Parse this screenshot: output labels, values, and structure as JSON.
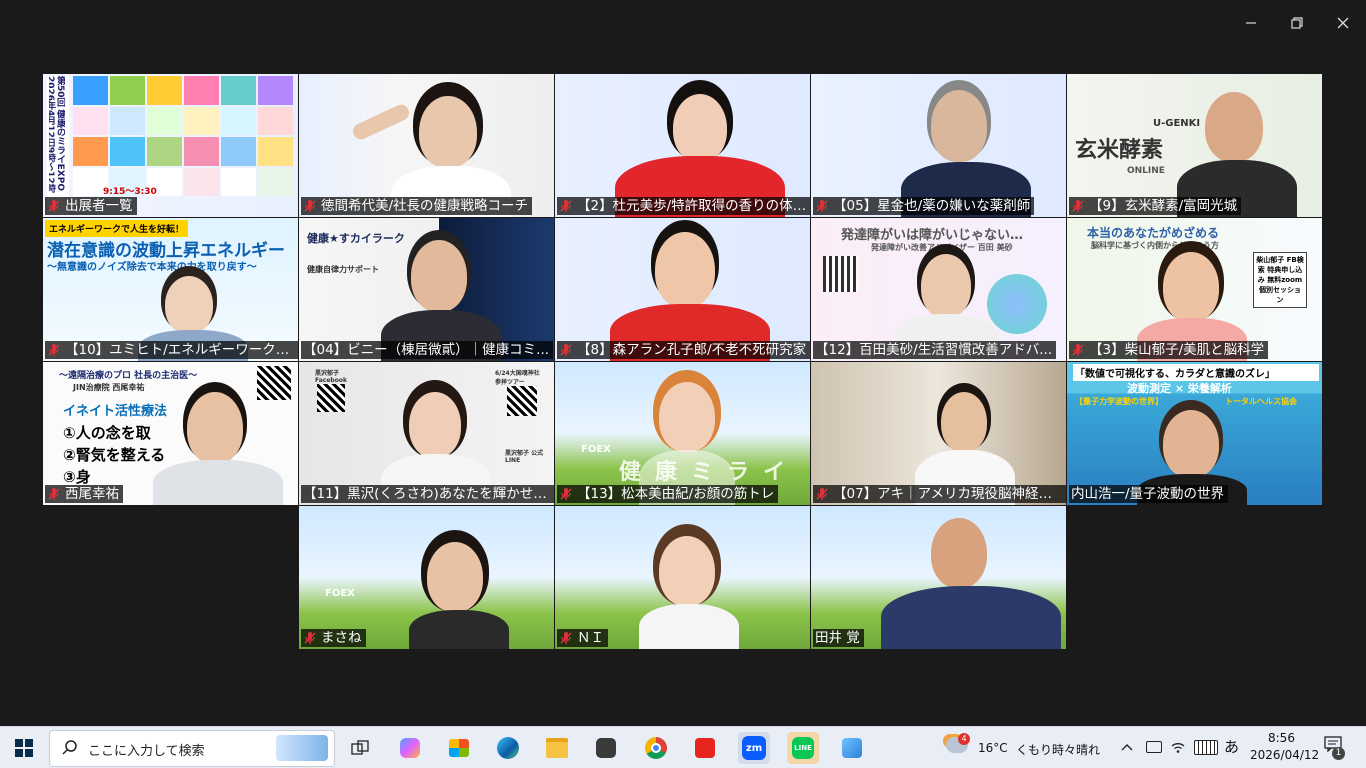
{
  "window": {
    "minimize_icon": "minimize-icon",
    "restore_icon": "restore-icon",
    "close_icon": "close-icon"
  },
  "participants": [
    {
      "name": "出展者一覧",
      "muted": true,
      "kind": "poster"
    },
    {
      "name": "徳間希代美/社長の健康戦略コーチ",
      "muted": true,
      "kind": "person"
    },
    {
      "name": "【2】杜元美歩/特許取得の香りの体質...",
      "muted": true,
      "kind": "person"
    },
    {
      "name": "【05】星金也/薬の嫌いな薬剤師",
      "muted": true,
      "kind": "person"
    },
    {
      "name": "【9】玄米酵素/富岡光城",
      "muted": true,
      "kind": "person"
    },
    {
      "name": "【10】ユミヒト/エネルギーワークで人...",
      "muted": true,
      "kind": "person"
    },
    {
      "name": "【04】ビニー（棟居微貳）｜健康コミ...",
      "muted": false,
      "kind": "person"
    },
    {
      "name": "【8】森アラン孔子郎/不老不死研究家",
      "muted": true,
      "kind": "person"
    },
    {
      "name": "【12】百田美砂/生活習慣改善アドバ...",
      "muted": false,
      "kind": "person"
    },
    {
      "name": "【3】柴山郁子/美肌と脳科学",
      "muted": true,
      "kind": "person"
    },
    {
      "name": "西尾幸祐",
      "muted": true,
      "kind": "person"
    },
    {
      "name": "【11】黒沢(くろさわ)あなたを輝かせるソ...",
      "muted": false,
      "kind": "person"
    },
    {
      "name": "【13】松本美由紀/お顔の筋トレ",
      "muted": true,
      "kind": "person"
    },
    {
      "name": "【07】アキ｜アメリカ現役脳神経科...",
      "muted": true,
      "kind": "person"
    },
    {
      "name": "内山浩一/量子波動の世界",
      "muted": false,
      "kind": "person"
    },
    {
      "name": "まさね",
      "muted": true,
      "kind": "person"
    },
    {
      "name": "ＮＩ",
      "muted": true,
      "kind": "person"
    },
    {
      "name": "田井 覚",
      "muted": false,
      "kind": "person",
      "speaking": true
    }
  ],
  "posters": {
    "expo_vertical": "第50回 健康のミライEXPO 2026年4月12日9時〜12時",
    "expo_times": "9:15〜3:30",
    "energy_banner": "エネルギーワークで人生を好転！",
    "energy_title": "潜在意識の波動上昇エネルギー",
    "energy_sub": "〜無意識のノイズ除去で本来の力を取り戻す〜",
    "kenko_star": "健康★すカイラーク",
    "kenko_jiritsu": "健康自律力サポート",
    "genmai": "玄米酵素",
    "genki": "U-GENKI",
    "online": "ONLINE",
    "hattatsu_title": "発達障がいは障がいじゃない…",
    "hattatsu_sub": "発達障がい改善アドバイザー 百田 美砂",
    "hontou_title": "本当のあなたがめざめる",
    "hontou_sub": "脳科学に基づく内側からととのう方",
    "shibayama_card": "柴山郁子 FB検索 特典申し込み 無料zoom 個別セッション",
    "enkaku": "〜遠隔治療のプロ 社長の主治医〜",
    "jin": "JIN治療院 西尾幸祐",
    "ineito": "イネイト活性療法",
    "ineito_1": "①人の念を取",
    "ineito_2": "②腎気を整える",
    "ineito_3": "③身",
    "kurosawa_fb": "黒沢郁子 Facebook",
    "kurosawa_line": "黒沢郁子 公式LINE",
    "kurosawa_tour": "6/24大国魂神社 参拝ツアー",
    "kenkou_mirai": "健康ミライ",
    "foex": "FOEX",
    "hado_title": "「数値で可視化する、カラダと意識のズレ」",
    "hado_sub": "波動測定 × 栄養解析",
    "hado_left": "【量子力学波動の世界】",
    "hado_right": "トータルヘルス協会"
  },
  "taskbar": {
    "search_placeholder": "ここに入力して検索",
    "weather_temp": "16°C",
    "weather_text": "くもり時々晴れ",
    "weather_badge": "4",
    "ime": "あ",
    "time": "8:56",
    "date": "2026/04/12",
    "notification_count": "1",
    "apps": [
      "task-view-icon",
      "copilot-icon",
      "store-icon",
      "edge-icon",
      "file-explorer-icon",
      "app-icon",
      "chrome-icon",
      "acrobat-icon",
      "zoom-icon",
      "line-icon",
      "app2-icon"
    ]
  },
  "colors": {
    "speaking_border": "#2fbf71",
    "mic_muted": "#e0303a",
    "zoom_blue": "#0b5cff",
    "line_green": "#06c755"
  }
}
